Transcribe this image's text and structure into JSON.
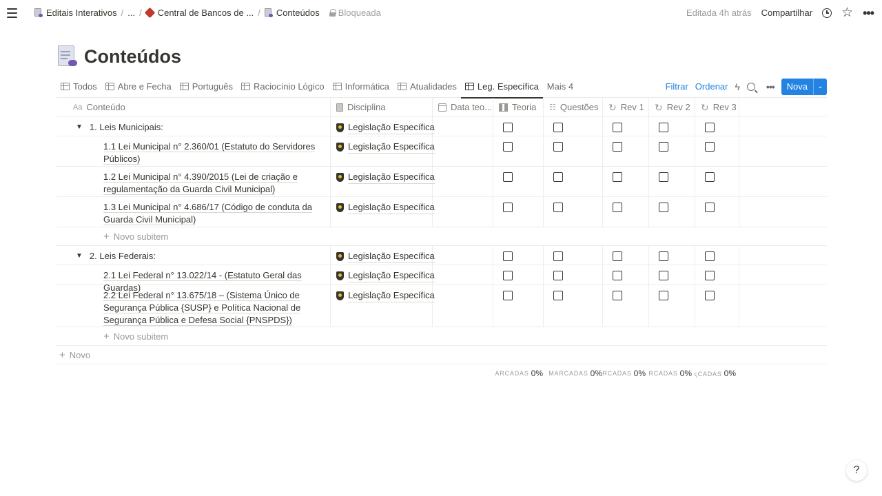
{
  "topbar": {
    "breadcrumbs": [
      "Editais Interativos",
      "...",
      "Central de Bancos de ...",
      "Conteúdos"
    ],
    "lock_label": "Bloqueada",
    "edited": "Editada 4h atrás",
    "share": "Compartilhar"
  },
  "page": {
    "title": "Conteúdos"
  },
  "tabs": {
    "items": [
      "Todos",
      "Abre e Fecha",
      "Português",
      "Raciocínio Lógico",
      "Informática",
      "Atualidades",
      "Leg. Específica"
    ],
    "more": "Mais 4",
    "active": "Leg. Específica",
    "filter": "Filtrar",
    "sort": "Ordenar",
    "new": "Nova"
  },
  "table": {
    "headers": {
      "aa": "Aa",
      "name": "Conteúdo",
      "disciplina": "Disciplina",
      "data": "Data teo...",
      "teoria": "Teoria",
      "questoes": "Questões",
      "rev1": "Rev 1",
      "rev2": "Rev 2",
      "rev3": "Rev 3"
    },
    "groups": [
      {
        "name": "1. Leis Municipais:",
        "disciplina": "Legislação Específica",
        "children": [
          {
            "name": "1.1 Lei Municipal n° 2.360/01 (Estatuto do Servidores Públicos)",
            "disciplina": "Legislação Específica"
          },
          {
            "name": "1.2 Lei Municipal n° 4.390/2015 (Lei de criação e regulamentação da Guarda Civil Municipal)",
            "disciplina": "Legislação Específica"
          },
          {
            "name": "1.3 Lei Municipal n° 4.686/17 (Código de conduta da Guarda Civil Municipal)",
            "disciplina": "Legislação Específica"
          }
        ]
      },
      {
        "name": "2. Leis Federais:",
        "disciplina": "Legislação Específica",
        "children": [
          {
            "name": "2.1 Lei Federal n° 13.022/14 - (Estatuto Geral das Guardas)",
            "disciplina": "Legislação Específica"
          },
          {
            "name": "2.2 Lei Federal n° 13.675/18 – (Sistema Único de Segurança Pública {SUSP} e Política Nacional de Segurança Pública e Defesa Social {PNSPDS})",
            "disciplina": "Legislação Específica"
          }
        ]
      }
    ],
    "new_subitem": "Novo subitem",
    "new_row": "Novo"
  },
  "summary": [
    {
      "label": "ARCADAS",
      "value": "0%"
    },
    {
      "label": "MARCADAS",
      "value": "0%"
    },
    {
      "label": "RCADAS",
      "value": "0%"
    },
    {
      "label": "RCADAS",
      "value": "0%"
    },
    {
      "label": "ꞔCADAS",
      "value": "0%"
    }
  ],
  "help": "?"
}
